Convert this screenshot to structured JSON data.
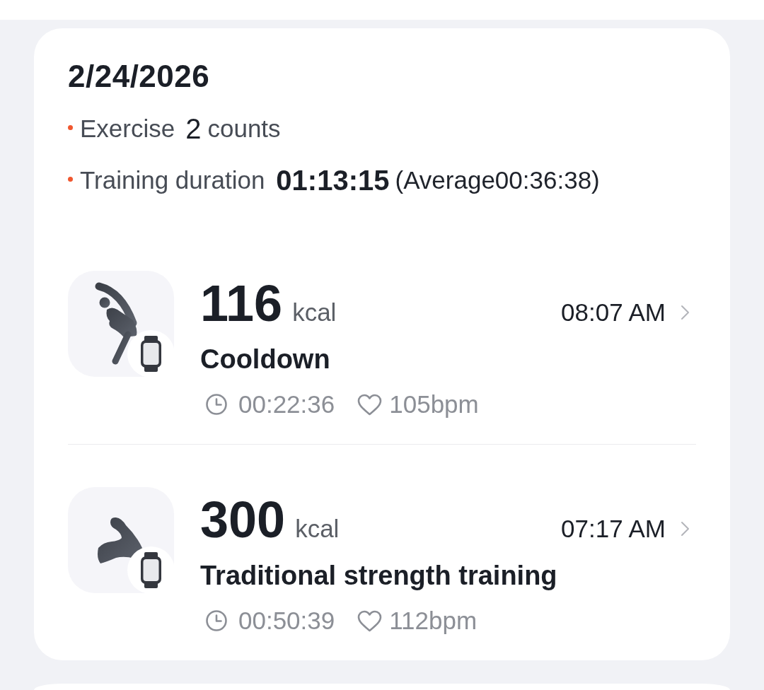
{
  "day_summary": {
    "date": "2/24/2026",
    "stats": [
      {
        "kind": "count",
        "label": "Exercise",
        "value": "2",
        "unit": "counts"
      },
      {
        "kind": "duration",
        "label": "Training duration",
        "value": "01:13:15",
        "note": "(Average00:36:38)"
      }
    ]
  },
  "workouts": [
    {
      "kind": "stretching",
      "watch_synced": true,
      "calories": "116",
      "calorie_unit": "kcal",
      "start_time": "08:07 AM",
      "name": "Cooldown",
      "duration": "00:22:36",
      "heart_rate": "105bpm"
    },
    {
      "kind": "strength",
      "watch_synced": true,
      "calories": "300",
      "calorie_unit": "kcal",
      "start_time": "07:17 AM",
      "name": "Traditional strength training",
      "duration": "00:50:39",
      "heart_rate": "112bpm"
    }
  ]
}
